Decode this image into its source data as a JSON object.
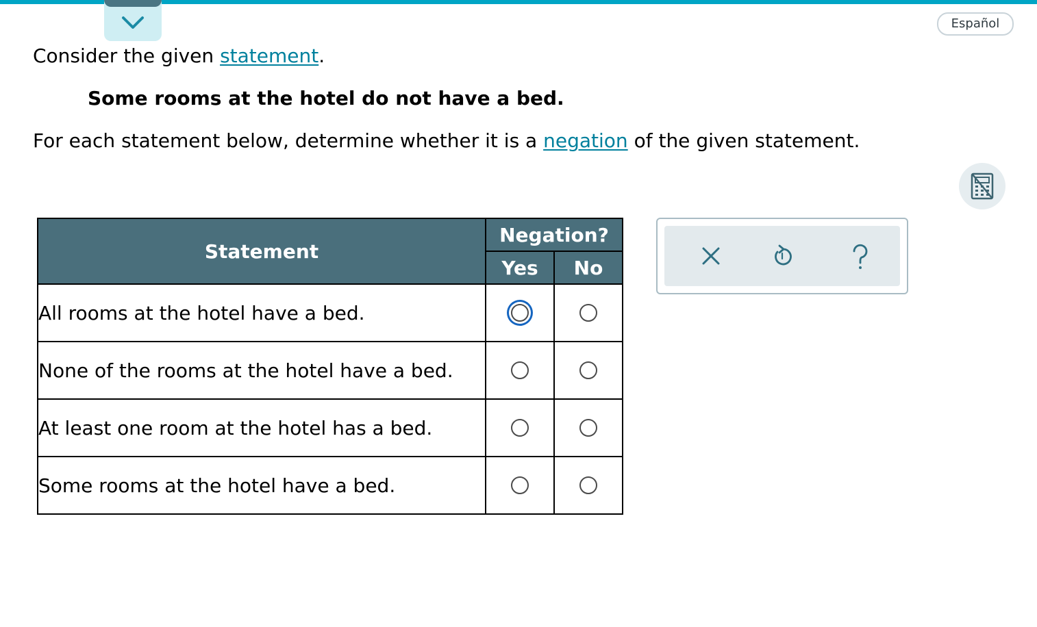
{
  "header": {
    "language_label": "Español",
    "accent_color": "#00a5c5",
    "collapse_icon": "chevron-down-icon"
  },
  "question": {
    "intro_before": "Consider the given ",
    "intro_link": "statement",
    "intro_after": ".",
    "given_statement": "Some rooms at the hotel do not have a bed.",
    "instruction_before": "For each statement below, determine whether it is a ",
    "instruction_link": "negation",
    "instruction_after": " of the given statement."
  },
  "table": {
    "statement_header": "Statement",
    "negation_header": "Negation?",
    "yes_label": "Yes",
    "no_label": "No",
    "header_color": "#4a6f7c",
    "rows": [
      {
        "statement": "All rooms at the hotel have a bed."
      },
      {
        "statement": "None of the rooms at the hotel have a bed."
      },
      {
        "statement": "At least one room at the hotel has a bed."
      },
      {
        "statement": "Some rooms at the hotel have a bed."
      }
    ]
  },
  "tools": {
    "icons": [
      "close-icon",
      "undo-icon",
      "help-icon"
    ],
    "side_icon": "calculator-icon"
  }
}
